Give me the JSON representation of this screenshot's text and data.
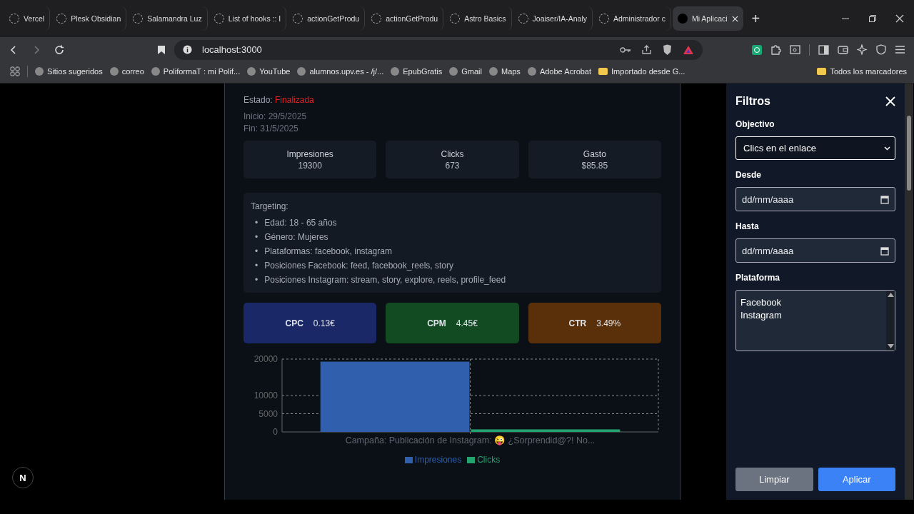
{
  "browser": {
    "tabs": [
      {
        "title": "Vercel",
        "selected": false
      },
      {
        "title": "Plesk Obsidian",
        "selected": false
      },
      {
        "title": "Salamandra Luz",
        "selected": false
      },
      {
        "title": "List of hooks :: I",
        "selected": false
      },
      {
        "title": "actionGetProdu",
        "selected": false
      },
      {
        "title": "actionGetProdu",
        "selected": false
      },
      {
        "title": "Astro Basics",
        "selected": false
      },
      {
        "title": "Joaiser/IA-Analy",
        "selected": false
      },
      {
        "title": "Administrador c",
        "selected": false
      },
      {
        "title": "Mi Aplicaci",
        "selected": true
      }
    ],
    "new_tab": "+",
    "address": "localhost:3000",
    "bookmarks": [
      "Sitios sugeridos",
      "correo",
      "PoliformaT : mi Polif...",
      "YouTube",
      "alumnos.upv.es - /j/...",
      "EpubGratis",
      "Gmail",
      "Maps",
      "Adobe Acrobat",
      "Importado desde G..."
    ],
    "all_bookmarks": "Todos los marcadores"
  },
  "campaign": {
    "status_label": "Estado:",
    "status": "Finalizada",
    "start": "Inicio: 29/5/2025",
    "end": "Fin: 31/5/2025",
    "stats": [
      {
        "label": "Impresiones",
        "value": "19300"
      },
      {
        "label": "Clicks",
        "value": "673"
      },
      {
        "label": "Gasto",
        "value": "$85.85"
      }
    ],
    "targeting": {
      "title": "Targeting:",
      "items": [
        {
          "marker": "•",
          "text": "Edad: 18 - 65 años"
        },
        {
          "marker": "•",
          "text": "Género: Mujeres"
        },
        {
          "marker": "•",
          "text": "Plataformas: facebook, instagram"
        },
        {
          "marker": "•",
          "text": "Posiciones Facebook: feed, facebook_reels, story"
        },
        {
          "marker": "•",
          "text": "Posiciones Instagram: stream, story, explore, reels, profile_feed"
        }
      ]
    },
    "metrics": [
      {
        "label": "CPC",
        "value": "0.13€",
        "color": "#1a2868"
      },
      {
        "label": "CPM",
        "value": "4.45€",
        "color": "#124a22"
      },
      {
        "label": "CTR",
        "value": "3.49%",
        "color": "#5a300b"
      }
    ],
    "chart_data": {
      "type": "bar",
      "categories": [
        "Campaña: Publicación de Instagram: 😜 ¿Sorprendid@?! No..."
      ],
      "series": [
        {
          "name": "Impresiones",
          "color": "#2f5fad",
          "values": [
            19300
          ]
        },
        {
          "name": "Clicks",
          "color": "#23a36f",
          "values": [
            700
          ]
        }
      ],
      "ylim": [
        0,
        20000
      ],
      "yticks": [
        0,
        5000,
        10000,
        20000
      ],
      "grid": true,
      "legend": "bottom"
    }
  },
  "filters": {
    "title": "Filtros",
    "fields": [
      {
        "kind": "select",
        "label": "Objectivo",
        "value": "Clics en el enlace"
      },
      {
        "kind": "date",
        "label": "Desde",
        "placeholder": "dd/mm/aaaa"
      },
      {
        "kind": "date",
        "label": "Hasta",
        "placeholder": "dd/mm/aaaa"
      },
      {
        "kind": "multiselect",
        "label": "Plataforma",
        "options": [
          "Facebook",
          "Instagram"
        ]
      }
    ],
    "buttons": [
      {
        "label": "Limpiar",
        "kind": "secondary"
      },
      {
        "label": "Aplicar",
        "kind": "primary"
      }
    ]
  },
  "dev_badge": "N"
}
